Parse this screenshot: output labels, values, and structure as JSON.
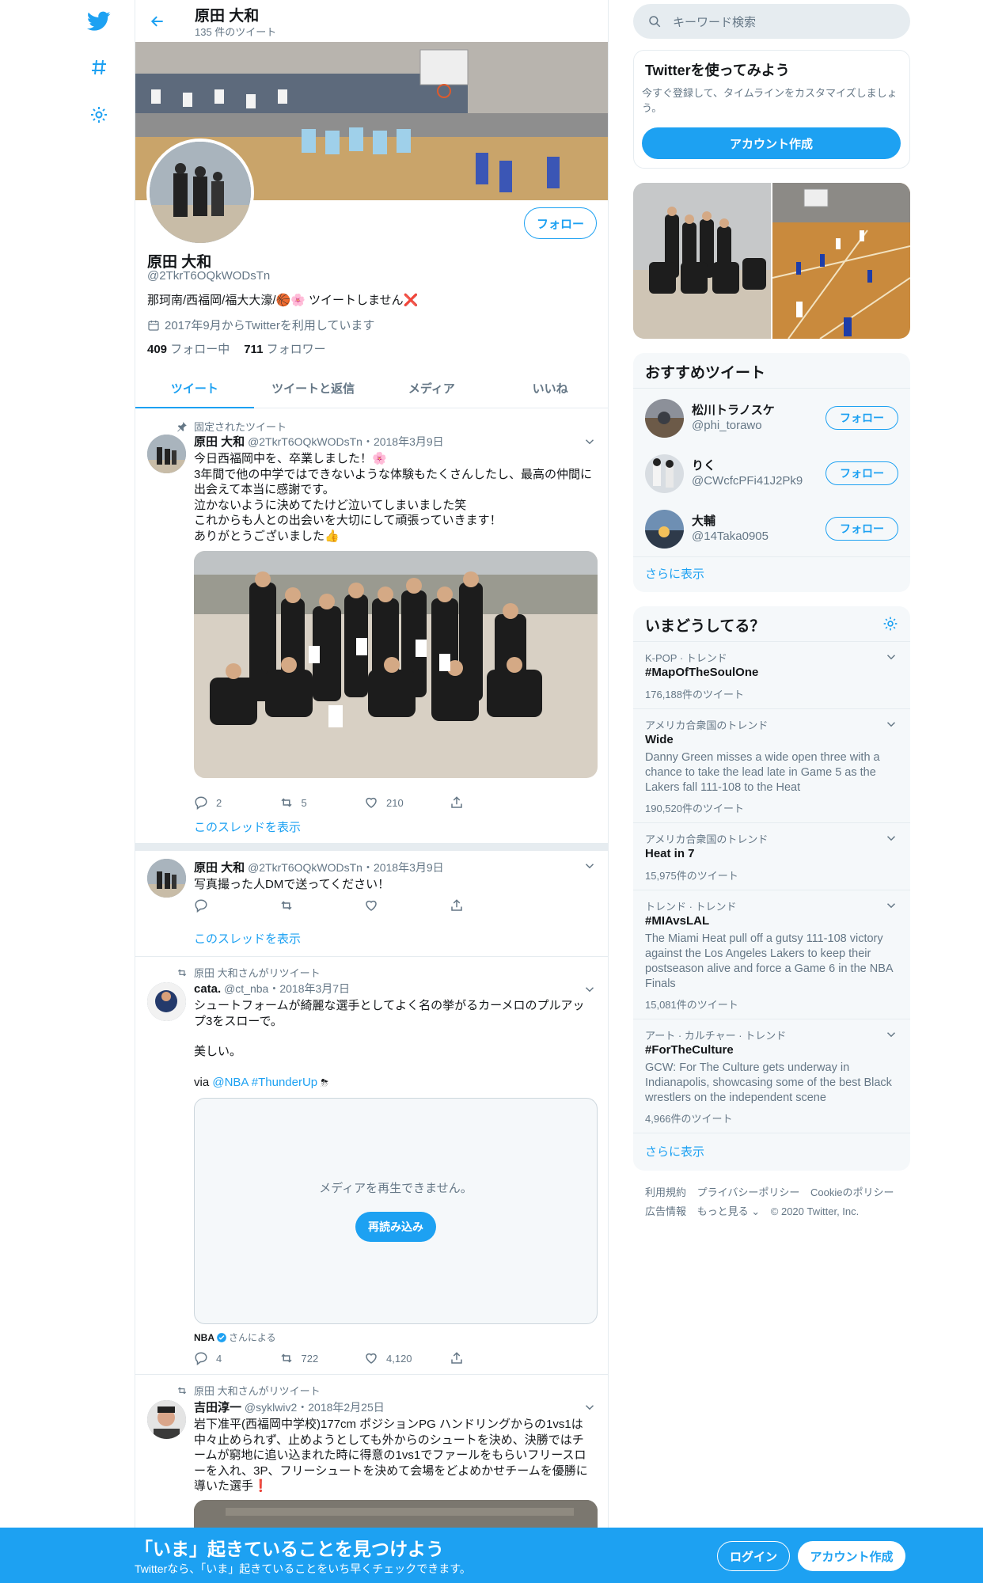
{
  "colors": {
    "accent": "#1da1f2",
    "muted": "#657786",
    "border": "#e6ecf0",
    "background_panel": "#f5f8fa"
  },
  "nav": {
    "icons": [
      "twitter-logo",
      "hashtag-icon",
      "gear-icon"
    ]
  },
  "header": {
    "name": "原田 大和",
    "tweet_count": "135 件のツイート"
  },
  "profile": {
    "name": "原田 大和",
    "handle": "@2TkrT6OQkWODsTn",
    "bio": "那珂南/西福岡/福大大濠/🏀🌸 ツイートしません❌",
    "joined": "2017年9月からTwitterを利用しています",
    "following_count": "409",
    "following_label": "フォロー中",
    "followers_count": "711",
    "followers_label": "フォロワー",
    "follow_button": "フォロー"
  },
  "tabs": [
    "ツイート",
    "ツイートと返信",
    "メディア",
    "いいね"
  ],
  "tweets": [
    {
      "pinned_label": "固定されたツイート",
      "name": "原田 大和",
      "handle": "@2TkrT6OQkWODsTn",
      "date": "・2018年3月9日",
      "lines": [
        "今日西福岡中を、卒業しました！🌸",
        "3年間で他の中学ではできないような体験もたくさんしたし、最高の仲間に",
        "出会えて本当に感謝です。",
        "泣かないように決めてたけど泣いてしまいました笑",
        "これからも人との出会いを大切にして頑張っていきます！",
        "ありがとうございました👍"
      ],
      "replies": "2",
      "retweets": "5",
      "likes": "210",
      "thread_link": "このスレッドを表示"
    },
    {
      "name": "原田 大和",
      "handle": "@2TkrT6OQkWODsTn",
      "date": "・2018年3月9日",
      "text": "写真撮った人DMで送ってください！",
      "thread_link": "このスレッドを表示"
    },
    {
      "retweeted_by": "原田 大和さんがリツイート",
      "name": "cata.",
      "handle": "@ct_nba",
      "date": "・2018年3月7日",
      "lines": [
        "シュートフォームが綺麗な選手としてよく名の挙がるカーメロのプルアッ",
        "プ3をスローで。"
      ],
      "line2": "美しい。",
      "via_prefix": "via ",
      "via_mention": "@NBA",
      "via_hashtag": "#ThunderUp",
      "media_error": "メディアを再生できません。",
      "reload": "再読み込み",
      "source_name": "NBA",
      "source_suffix": "さんによる",
      "replies": "4",
      "retweets": "722",
      "likes": "4,120"
    },
    {
      "retweeted_by": "原田 大和さんがリツイート",
      "name": "吉田淳一",
      "handle": "@syklwiv2",
      "date": "・2018年2月25日",
      "lines": [
        "岩下准平(西福岡中学校)177cm ポジションPG ハンドリングからの1vs1は",
        "中々止められず、止めようとしても外からのシュートを決め、決勝ではチ",
        "ームが窮地に追い込まれた時に得意の1vs1でファールをもらいフリースロ",
        "ーを入れ、3P、フリーシュートを決めて会場をどよめかせチームを優勝に",
        "導いた選手❗"
      ]
    }
  ],
  "sidebar": {
    "search_placeholder": "キーワード検索",
    "signup_card": {
      "title": "Twitterを使ってみよう",
      "desc_lines": [
        "今すぐ登録して、タイムラインをカスタマイズしましょ",
        "う。"
      ],
      "button": "アカウント作成"
    },
    "recommend": {
      "title": "おすすめツイート",
      "users": [
        {
          "name": "松川トラノスケ",
          "handle": "@phi_torawo",
          "button": "フォロー"
        },
        {
          "name": "りく",
          "handle": "@CWcfcPFi41J2Pk9",
          "button": "フォロー"
        },
        {
          "name": "大輔",
          "handle": "@14Taka0905",
          "button": "フォロー"
        }
      ],
      "more": "さらに表示"
    },
    "trends": {
      "title": "いまどうしてる？",
      "items": [
        {
          "context": "K-POP · トレンド",
          "name": "#MapOfTheSoulOne",
          "count": "176,188件のツイート"
        },
        {
          "context": "アメリカ合衆国のトレンド",
          "name": "Wide",
          "desc": "Danny Green misses a wide open three with a chance to take the lead late in Game 5 as the Lakers fall 111-108 to the Heat",
          "count": "190,520件のツイート"
        },
        {
          "context": "アメリカ合衆国のトレンド",
          "name": "Heat in 7",
          "count": "15,975件のツイート"
        },
        {
          "context": "トレンド · トレンド",
          "name": "#MIAvsLAL",
          "desc": "The Miami Heat pull off a gutsy 111-108 victory against the Los Angeles Lakers to keep their postseason alive and force a Game 6 in the NBA Finals",
          "count": "15,081件のツイート"
        },
        {
          "context": "アート · カルチャー · トレンド",
          "name": "#ForTheCulture",
          "desc": "GCW: For The Culture gets underway in Indianapolis, showcasing some of the best Black wrestlers on the independent scene",
          "count": "4,966件のツイート"
        }
      ],
      "more": "さらに表示"
    },
    "footer": {
      "links1": [
        "利用規約",
        "プライバシーポリシー",
        "Cookieのポリシー"
      ],
      "links2": [
        "広告情報",
        "もっと見る ⌄",
        "© 2020 Twitter, Inc."
      ]
    }
  },
  "bottom_bar": {
    "title": "「いま」起きていることを見つけよう",
    "subtitle": "Twitterなら、「いま」起きていることをいち早くチェックできます。",
    "login": "ログイン",
    "signup": "アカウント作成"
  }
}
